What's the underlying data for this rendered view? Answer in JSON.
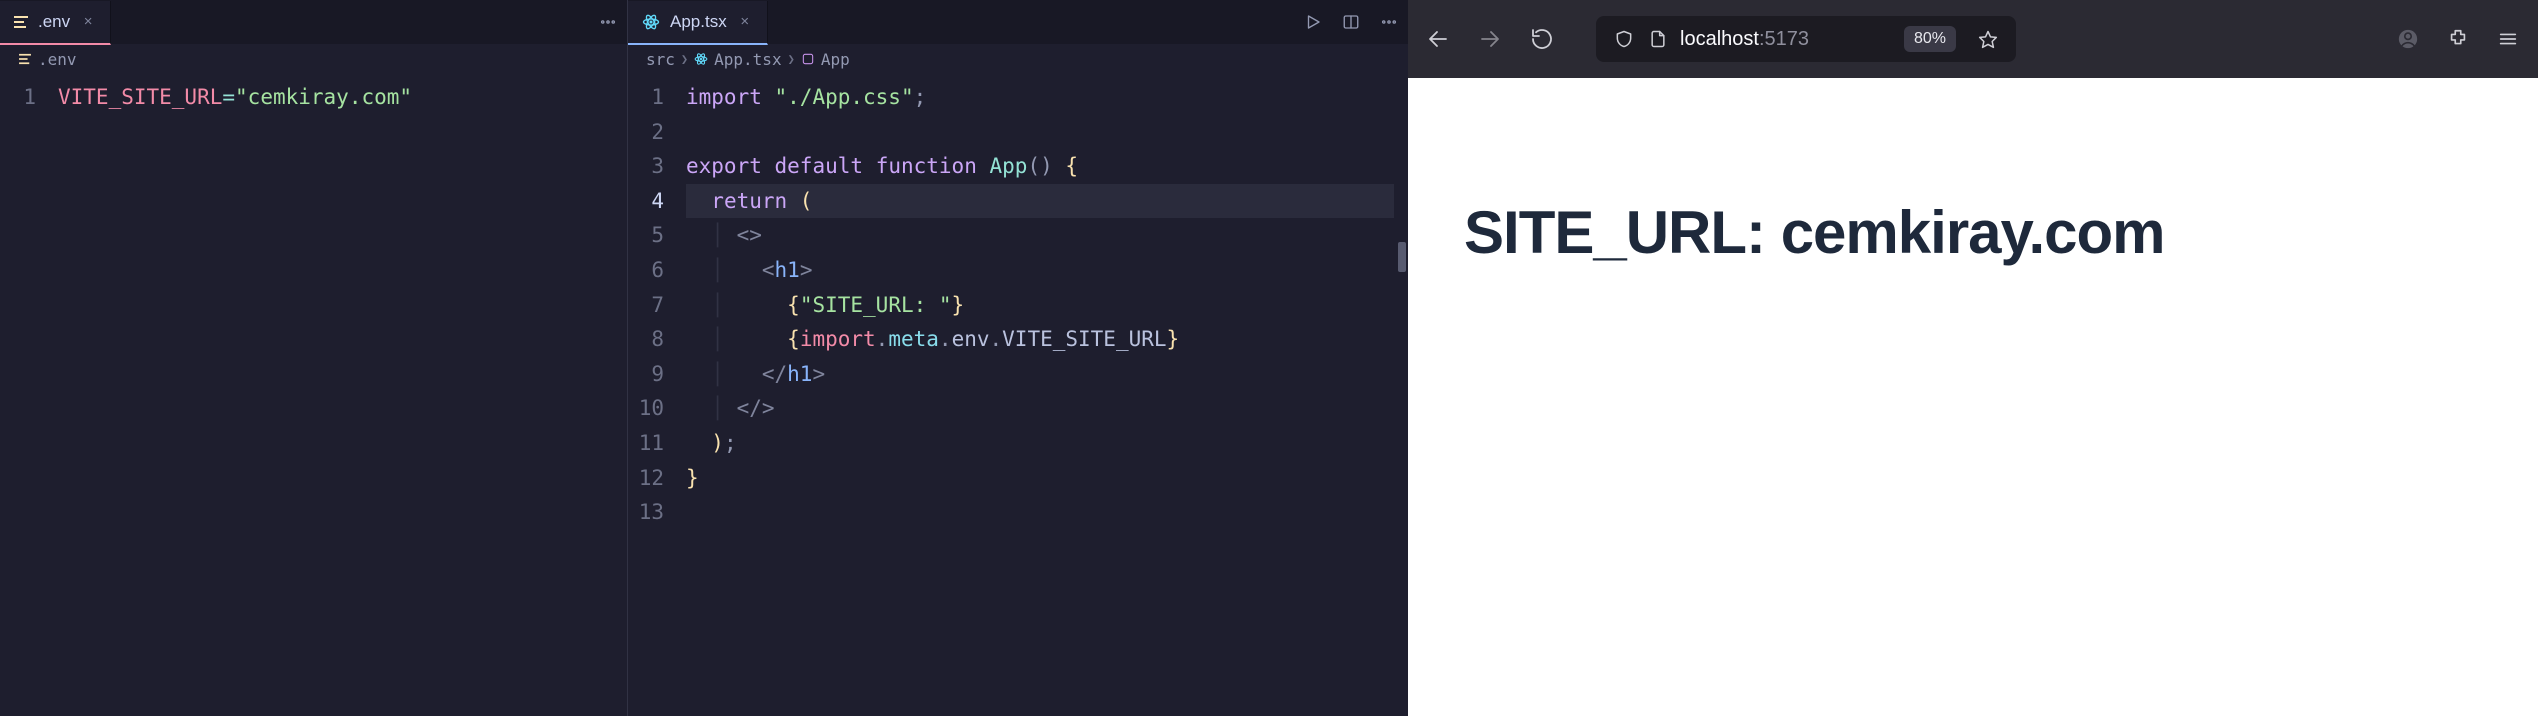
{
  "editor": {
    "left": {
      "tab": {
        "label": ".env",
        "icon": "env-file-icon"
      },
      "breadcrumb": [
        {
          "icon": "env-file-icon",
          "label": ".env"
        }
      ],
      "lines": [
        1
      ],
      "code": {
        "l1": {
          "key": "VITE_SITE_URL",
          "op": "=",
          "str": "\"cemkiray.com\""
        }
      }
    },
    "right": {
      "tab": {
        "label": "App.tsx",
        "icon": "react-file-icon"
      },
      "actions": [
        "run-icon",
        "split-icon",
        "more-icon"
      ],
      "breadcrumb": [
        {
          "label": "src"
        },
        {
          "icon": "react-file-icon",
          "label": "App.tsx"
        },
        {
          "icon": "symbol-method-icon",
          "label": "App"
        }
      ],
      "lines": [
        1,
        2,
        3,
        4,
        5,
        6,
        7,
        8,
        9,
        10,
        11,
        12,
        13
      ],
      "code": {
        "l1": {
          "kw1": "import",
          "str": "\"./App.css\"",
          "sc": ";"
        },
        "l3": {
          "kw1": "export",
          "kw2": "default",
          "kw3": "function",
          "fn": "App",
          "pc": "()",
          "ob": " {"
        },
        "l4": {
          "kw1": "return",
          "op": " ("
        },
        "l5": {
          "txt": "<>"
        },
        "l6": {
          "open": "<",
          "tag": "h1",
          "close": ">"
        },
        "l7": {
          "ob": "{",
          "str": "\"SITE_URL: \"",
          "cb": "}"
        },
        "l8": {
          "ob": "{",
          "a": "import",
          "d1": ".",
          "b": "meta",
          "d2": ".",
          "c": "env",
          "d3": ".",
          "d": "VITE_SITE_URL",
          "cb": "}"
        },
        "l9": {
          "open": "</",
          "tag": "h1",
          "close": ">"
        },
        "l10": {
          "txt": "</>"
        },
        "l11": {
          "cp": ")",
          "sc": ";"
        },
        "l12": {
          "cb": "}"
        }
      }
    }
  },
  "browser": {
    "url": {
      "host": "localhost",
      "port": ":5173"
    },
    "zoom": "80%",
    "page": {
      "heading": "SITE_URL: cemkiray.com"
    }
  }
}
